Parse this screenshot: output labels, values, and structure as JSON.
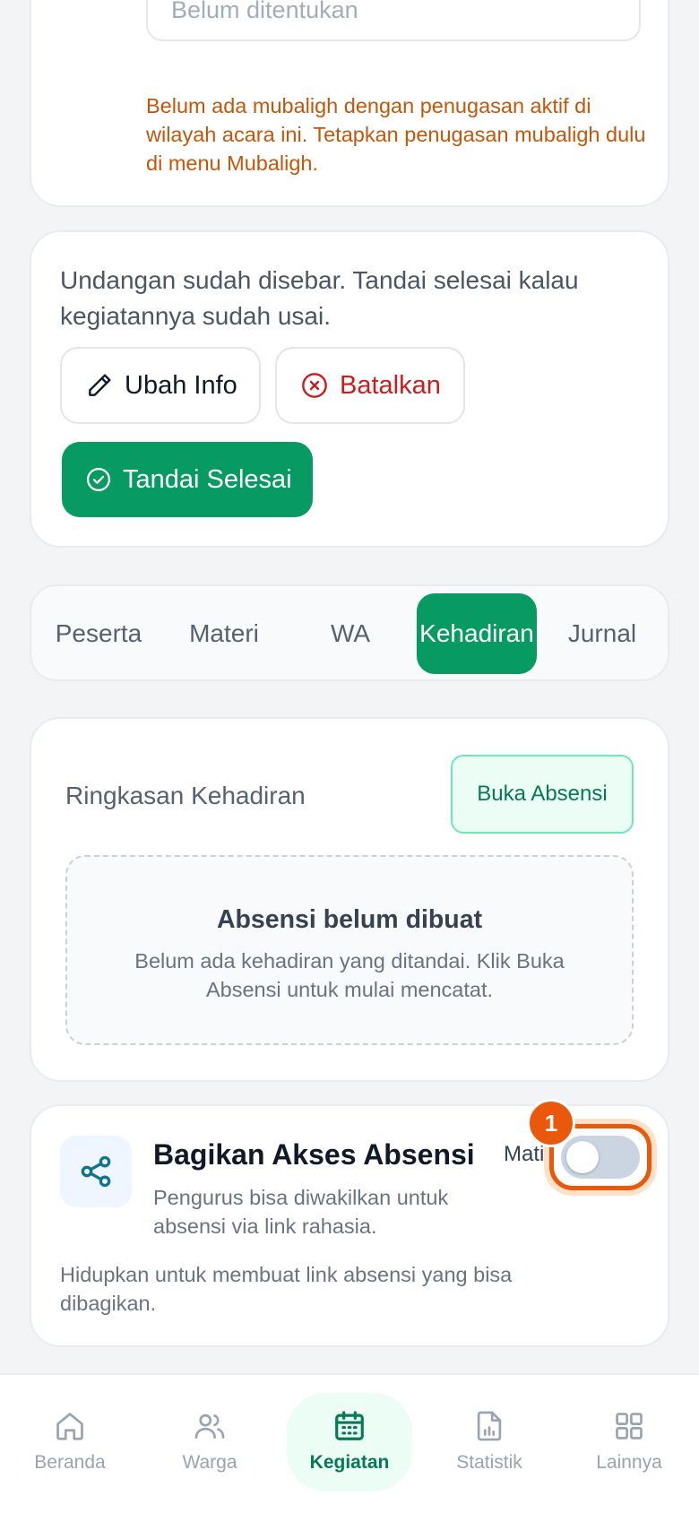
{
  "mubaligh": {
    "placeholder": "Belum ditentukan",
    "warning": "Belum ada mubaligh dengan penugasan aktif di wilayah acara ini. Tetapkan penugasan mubaligh dulu di menu Mubaligh."
  },
  "status_card": {
    "text": "Undangan sudah disebar. Tandai selesai kalau kegiatannya sudah usai.",
    "edit_label": "Ubah Info",
    "cancel_label": "Batalkan",
    "done_label": "Tandai Selesai"
  },
  "tabs": [
    {
      "label": "Peserta",
      "active": false
    },
    {
      "label": "Materi",
      "active": false
    },
    {
      "label": "WA",
      "active": false
    },
    {
      "label": "Kehadiran",
      "active": true
    },
    {
      "label": "Jurnal",
      "active": false
    }
  ],
  "attendance": {
    "title": "Ringkasan Kehadiran",
    "open_button": "Buka Absensi",
    "empty_title": "Absensi belum dibuat",
    "empty_desc": "Belum ada kehadiran yang ditandai. Klik Buka Absensi untuk mulai mencatat."
  },
  "share": {
    "title": "Bagikan Akses Absensi",
    "desc": "Pengurus bisa diwakilkan untuk absensi via link rahasia.",
    "note": "Hidupkan untuk membuat link absensi yang bisa dibagikan.",
    "toggle_state": "Mati",
    "toggle_on": false,
    "badge": "1"
  },
  "nav": [
    {
      "label": "Beranda",
      "icon": "home-icon",
      "active": false
    },
    {
      "label": "Warga",
      "icon": "users-icon",
      "active": false
    },
    {
      "label": "Kegiatan",
      "icon": "calendar-icon",
      "active": true
    },
    {
      "label": "Statistik",
      "icon": "chart-file-icon",
      "active": false
    },
    {
      "label": "Lainnya",
      "icon": "grid-icon",
      "active": false
    }
  ],
  "colors": {
    "primary": "#079a62",
    "danger": "#c81e1e",
    "warning": "#c2570c",
    "highlight": "#ea580c"
  }
}
